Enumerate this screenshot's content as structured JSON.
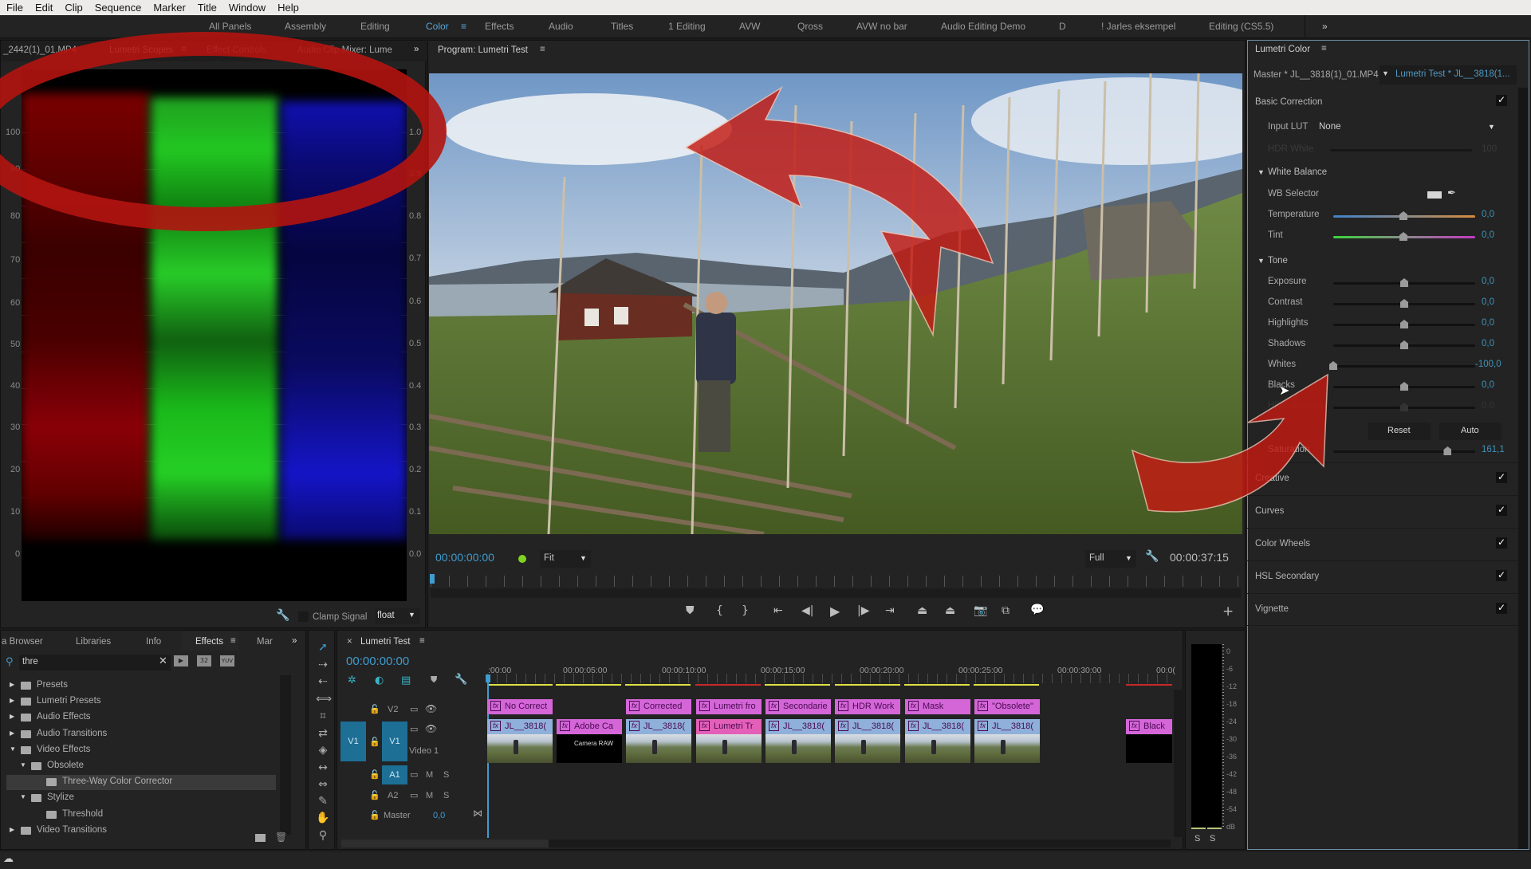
{
  "menu": [
    "File",
    "Edit",
    "Clip",
    "Sequence",
    "Marker",
    "Title",
    "Window",
    "Help"
  ],
  "workspaces": {
    "items": [
      "All Panels",
      "Assembly",
      "Editing",
      "Color",
      "Effects",
      "Audio",
      "Titles",
      "1 Editing",
      "AVW",
      "Qross",
      "AVW no bar",
      "Audio Editing Demo",
      "D",
      "! Jarles eksempel",
      "Editing (CS5.5)"
    ],
    "active": "Color",
    "overflow": "»"
  },
  "scopes_panel": {
    "tabs": [
      "_2442(1)_01.MP4",
      "Lumetri Scopes",
      "Effect Controls",
      "Audio Clip Mixer: Lume"
    ],
    "active_tab": "Lumetri Scopes",
    "overflow": "»",
    "left_axis": [
      "100",
      "90",
      "80",
      "70",
      "60",
      "50",
      "40",
      "30",
      "20",
      "10",
      "0"
    ],
    "right_axis": [
      "1.0",
      "0.9",
      "0.8",
      "0.7",
      "0.6",
      "0.5",
      "0.4",
      "0.3",
      "0.2",
      "0.1",
      "0.0"
    ],
    "clamp_signal_label": "Clamp Signal",
    "clamp_signal_checked": false,
    "bit_depth": "float"
  },
  "program_monitor": {
    "title": "Program: Lumetri Test",
    "timecode": "00:00:00:00",
    "zoom": "Fit",
    "resolution": "Full",
    "duration": "00:00:37:15",
    "status_color": "#7ed321"
  },
  "lumetri": {
    "title": "Lumetri Color",
    "master_clip": "Master * JL__3818(1)_01.MP4",
    "sequence_clip": "Lumetri Test * JL__3818(1...",
    "basic_correction": {
      "label": "Basic Correction",
      "enabled": true,
      "input_lut_label": "Input LUT",
      "input_lut_value": "None",
      "hdr_white_label": "HDR White",
      "hdr_white_value": "100",
      "white_balance": {
        "label": "White Balance",
        "wb_selector_label": "WB Selector",
        "temperature": {
          "label": "Temperature",
          "value": "0,0"
        },
        "tint": {
          "label": "Tint",
          "value": "0,0"
        }
      },
      "tone": {
        "label": "Tone",
        "sliders": [
          {
            "label": "Exposure",
            "value": "0,0",
            "position": 0.5
          },
          {
            "label": "Contrast",
            "value": "0,0",
            "position": 0.5
          },
          {
            "label": "Highlights",
            "value": "0,0",
            "position": 0.5
          },
          {
            "label": "Shadows",
            "value": "0,0",
            "position": 0.5
          },
          {
            "label": "Whites",
            "value": "-100,0",
            "position": 0.0
          },
          {
            "label": "Blacks",
            "value": "0,0",
            "position": 0.5
          },
          {
            "label": "HDR Specular",
            "value": "0,0",
            "position": 0.5
          }
        ],
        "reset_label": "Reset",
        "auto_label": "Auto",
        "saturation": {
          "label": "Saturation",
          "value": "161,1",
          "position": 0.806
        }
      }
    },
    "sections": [
      {
        "label": "Creative",
        "enabled": true
      },
      {
        "label": "Curves",
        "enabled": true
      },
      {
        "label": "Color Wheels",
        "enabled": true
      },
      {
        "label": "HSL Secondary",
        "enabled": true
      },
      {
        "label": "Vignette",
        "enabled": true
      }
    ]
  },
  "effects_panel": {
    "tabs": [
      "Media Browser",
      "Libraries",
      "Info",
      "Effects",
      "Markers"
    ],
    "tab_display": [
      "a Browser",
      "Libraries",
      "Info",
      "Effects",
      "Mar"
    ],
    "active_tab": "Effects",
    "search_value": "thre",
    "filter_buttons": [
      "accelerated-effects",
      "32-bit",
      "YUV"
    ],
    "tree": [
      {
        "label": "Presets",
        "depth": 0,
        "expanded": false,
        "type": "preset-folder"
      },
      {
        "label": "Lumetri Presets",
        "depth": 0,
        "expanded": false,
        "type": "preset-folder"
      },
      {
        "label": "Audio Effects",
        "depth": 0,
        "expanded": false,
        "type": "folder"
      },
      {
        "label": "Audio Transitions",
        "depth": 0,
        "expanded": false,
        "type": "folder"
      },
      {
        "label": "Video Effects",
        "depth": 0,
        "expanded": true,
        "type": "folder"
      },
      {
        "label": "Obsolete",
        "depth": 1,
        "expanded": true,
        "type": "folder"
      },
      {
        "label": "Three-Way Color Corrector",
        "depth": 2,
        "type": "effect",
        "selected": true
      },
      {
        "label": "Stylize",
        "depth": 1,
        "expanded": true,
        "type": "folder"
      },
      {
        "label": "Threshold",
        "depth": 2,
        "type": "effect"
      },
      {
        "label": "Video Transitions",
        "depth": 0,
        "expanded": false,
        "type": "folder"
      }
    ]
  },
  "timeline": {
    "title": "Lumetri Test",
    "timecode": "00:00:00:00",
    "ruler": [
      ":00:00",
      "00:00:05:00",
      "00:00:10:00",
      "00:00:15:00",
      "00:00:20:00",
      "00:00:25:00",
      "00:00:30:00",
      "00:0("
    ],
    "tracks": {
      "v2": "V2",
      "v1": "V1",
      "v1_source": "V1",
      "v1_name": "Video 1",
      "a1": "A1",
      "a2": "A2",
      "mute": "M",
      "solo": "S",
      "master": "Master",
      "master_value": "0,0"
    },
    "v2_clips": [
      "No Correct",
      "Corrected",
      "Lumetri fro",
      "Secondarie",
      "HDR Work",
      "Mask",
      "\"Obsolete\""
    ],
    "v1_clips": [
      "JL__3818(",
      "Adobe Ca",
      "JL__3818(",
      "Lumetri Tr",
      "JL__3818(",
      "JL__3818(",
      "JL__3818(",
      "JL__3818(",
      "Black"
    ],
    "camera_raw_label": "Camera RAW"
  },
  "audio_meter": {
    "scale": [
      "0",
      "-6",
      "-12",
      "-18",
      "-24",
      "-30",
      "-36",
      "-42",
      "-48",
      "-54",
      "dB"
    ],
    "solo_labels": [
      "S",
      "S"
    ]
  }
}
